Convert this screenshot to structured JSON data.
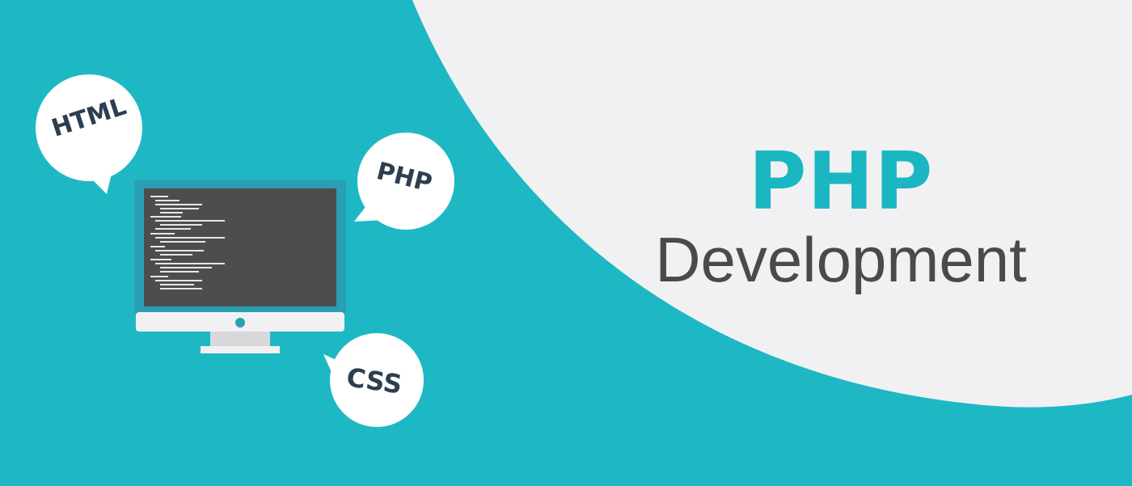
{
  "headline": {
    "main": "PHP",
    "sub": "Development"
  },
  "bubbles": {
    "html": "HTML",
    "php": "PHP",
    "css": "CSS"
  },
  "colors": {
    "teal_background": "#1eb8c4",
    "light_background": "#f1f1f3",
    "headline_teal": "#1ab6c2",
    "subtitle_gray": "#4a4a4c",
    "bubble_text": "#2d3e50",
    "screen": "#4d4d4f"
  },
  "icons": [
    "monitor-icon",
    "code-lines-icon",
    "speech-bubble-icon"
  ]
}
